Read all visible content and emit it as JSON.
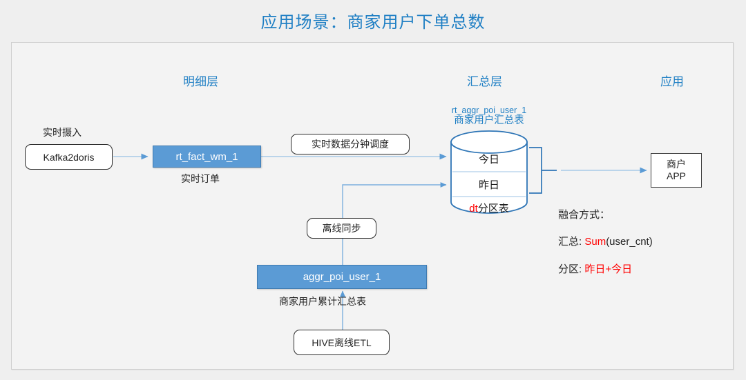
{
  "title": "应用场景：商家用户下单总数",
  "layers": [
    {
      "label": "明细层"
    },
    {
      "label": "汇总层"
    },
    {
      "label": "应用"
    }
  ],
  "nodes": {
    "ingest_label": "实时摄入",
    "kafka": "Kafka2doris",
    "rt_fact": "rt_fact_wm_1",
    "rt_fact_caption": "实时订单",
    "rt_schedule": "实时数据分钟调度",
    "offline_sync": "离线同步",
    "aggr_table": "aggr_poi_user_1",
    "aggr_caption": "商家用户累计汇总表",
    "hive_etl": "HIVE离线ETL",
    "app_line1": "商户",
    "app_line2": "APP"
  },
  "cylinder": {
    "name": "rt_aggr_poi_user_1",
    "caption": "商家用户汇总表",
    "rows": [
      {
        "text": "今日"
      },
      {
        "text": "昨日"
      }
    ],
    "partition_prefix": "dt",
    "partition_suffix": "分区表"
  },
  "fusion": {
    "heading": "融合方式：",
    "sum_label": "汇总: ",
    "sum_fn": "Sum",
    "sum_args": "(user_cnt)",
    "part_label": "分区: ",
    "part_value": "昨日+今日"
  },
  "colors": {
    "accent_blue": "#1f7fc4",
    "box_blue": "#5b9bd5",
    "arrow_blue": "#9dc3e6",
    "cyl_blue": "#2e75b6",
    "red": "#ff0000"
  }
}
